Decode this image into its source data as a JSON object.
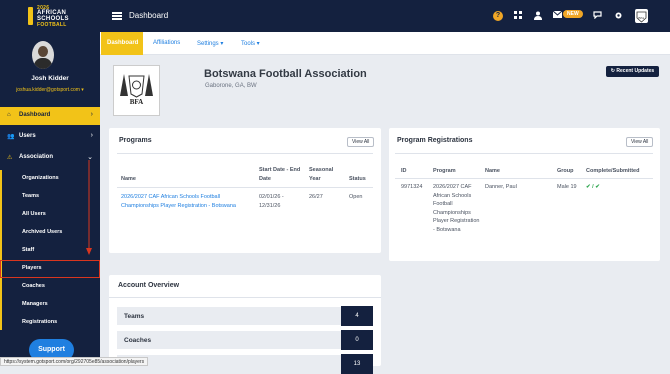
{
  "topbar": {
    "logo_lines": [
      "2026",
      "AFRICAN",
      "SCHOOLS",
      "FOOTBALL"
    ],
    "title": "Dashboard",
    "help_icon": "?",
    "new_badge": "NEW"
  },
  "sidebar": {
    "user_name": "Josh Kidder",
    "user_email": "joshua.kidder@gotsport.com",
    "nav": [
      {
        "label": "Dashboard",
        "icon": "home-icon"
      },
      {
        "label": "Users",
        "icon": "users-icon"
      },
      {
        "label": "Association",
        "icon": "warning-icon"
      }
    ],
    "sub_items": [
      "Organizations",
      "Teams",
      "All Users",
      "Archived Users",
      "Staff",
      "Players",
      "Coaches",
      "Managers",
      "Registrations"
    ],
    "support_label": "Support"
  },
  "subnav": {
    "items": [
      "Dashboard",
      "Affiliations",
      "Settings",
      "Tools"
    ]
  },
  "org": {
    "logo_text": "BFA",
    "name": "Botswana Football Association",
    "location": "Gaborone, GA, BW",
    "recent_updates": "Recent Updates"
  },
  "programs": {
    "title": "Programs",
    "view_all": "View All",
    "columns": [
      "Name",
      "Start Date - End Date",
      "Seasonal Year",
      "Status"
    ],
    "rows": [
      {
        "name": "2026/2027 CAF African Schools Football Championships Player Registration - Botswana",
        "dates": "02/01/26 - 12/31/26",
        "year": "26/27",
        "status": "Open"
      }
    ]
  },
  "program_registrations": {
    "title": "Program Registrations",
    "view_all": "View All",
    "columns": [
      "ID",
      "Program",
      "Name",
      "Group",
      "Complete/Submitted"
    ],
    "rows": [
      {
        "id": "9971324",
        "program": "2026/2027 CAF African Schools Football Championships Player Registration - Botswana",
        "name": "Danner, Paul",
        "group": "Male 19",
        "status": "✔ / ✔"
      }
    ]
  },
  "account_overview": {
    "title": "Account Overview",
    "rows": [
      {
        "label": "Teams",
        "value": "4"
      },
      {
        "label": "Coaches",
        "value": "0"
      },
      {
        "label": "",
        "value": "13"
      }
    ]
  },
  "statusbar": {
    "url": "https://system.gotsport.com/org/292705e85/association/players"
  },
  "colors": {
    "navy": "#14213f",
    "accent": "#f2c318",
    "link": "#1f7fe0",
    "highlight": "#d9361f"
  }
}
